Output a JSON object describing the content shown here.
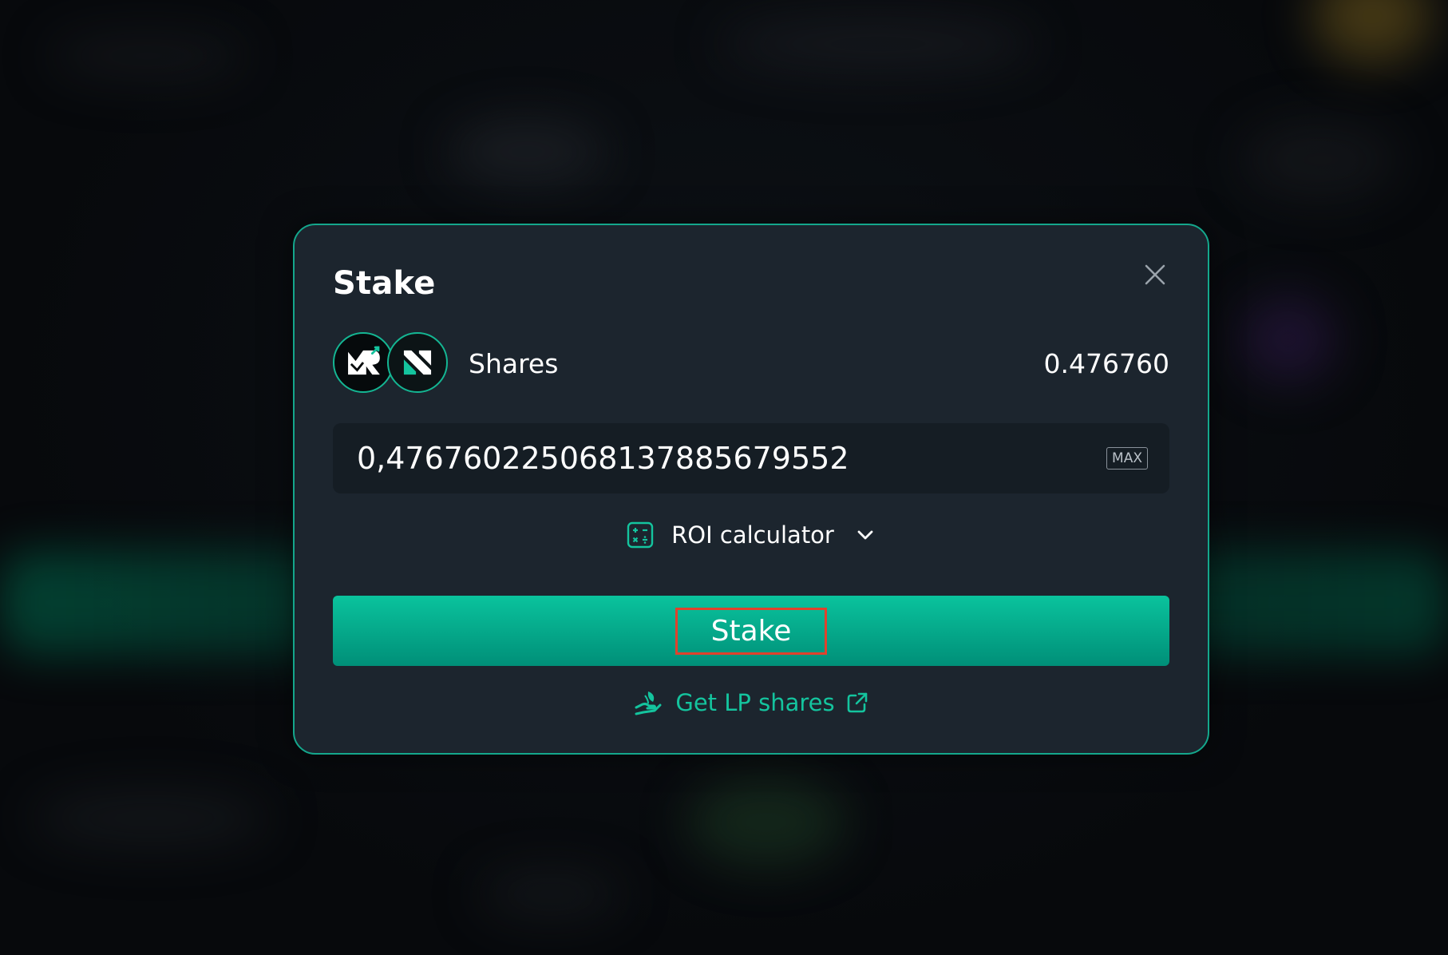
{
  "modal": {
    "title": "Stake",
    "close_icon": "close-icon"
  },
  "token": {
    "label": "Shares",
    "balance": "0.476760",
    "icons": [
      "token-a-logo-icon",
      "token-b-logo-icon"
    ]
  },
  "amount_input": {
    "value": "0,476760225068137885679552",
    "max_label": "MAX"
  },
  "roi": {
    "label": "ROI calculator",
    "icon": "calculator-icon",
    "toggle_icon": "chevron-down-icon"
  },
  "stake_button": {
    "label": "Stake"
  },
  "lp_link": {
    "label": "Get LP shares",
    "icon": "hand-plant-icon",
    "external_icon": "external-link-icon"
  },
  "colors": {
    "accent": "#14c49e",
    "modal_border": "#14a78c",
    "modal_bg": "#1c252e",
    "input_bg": "#151d24",
    "highlight": "#e0422c"
  }
}
